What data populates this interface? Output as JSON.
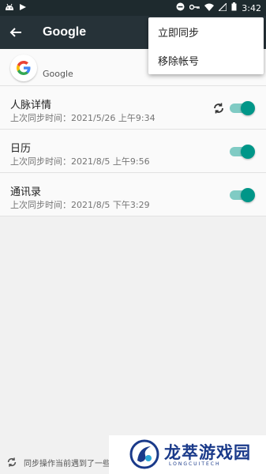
{
  "status_bar": {
    "time": "3:42"
  },
  "toolbar": {
    "title": "Google"
  },
  "account": {
    "name": "Google"
  },
  "sync_items": [
    {
      "name": "人脉详情",
      "last_sync": "上次同步时间：2021/5/26 上午9:34",
      "enabled": true,
      "syncing": true
    },
    {
      "name": "日历",
      "last_sync": "上次同步时间：2021/8/5 上午9:56",
      "enabled": true,
      "syncing": false
    },
    {
      "name": "通讯录",
      "last_sync": "上次同步时间：2021/8/5 下午3:29",
      "enabled": true,
      "syncing": false
    }
  ],
  "menu": {
    "items": [
      "立即同步",
      "移除帐号"
    ]
  },
  "footer": {
    "text": "同步操作当前遇到了一些问题"
  },
  "watermark": {
    "title": "龙萃游戏园",
    "subtitle": "LONGCUITECH"
  },
  "colors": {
    "accent": "#009688",
    "accent_track": "#80cbc4",
    "toolbar": "#263238",
    "brand_blue": "#1a3a8a"
  }
}
